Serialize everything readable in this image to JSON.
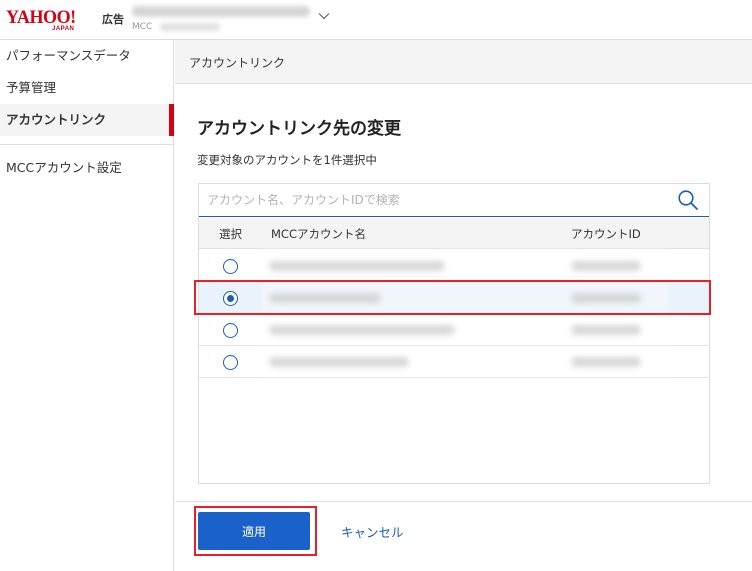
{
  "brand": {
    "logo_text": "YAHOO!",
    "logo_sub": "JAPAN",
    "product": "広告"
  },
  "account_selector": {
    "type_label": "MCC"
  },
  "sidebar": {
    "items": [
      {
        "label": "パフォーマンスデータ",
        "active": false
      },
      {
        "label": "予算管理",
        "active": false
      },
      {
        "label": "アカウントリンク",
        "active": true
      },
      {
        "label": "MCCアカウント設定",
        "active": false
      }
    ]
  },
  "page_header": {
    "title": "アカウントリンク"
  },
  "main": {
    "section_title": "アカウントリンク先の変更",
    "selected_count_text": "変更対象のアカウントを1件選択中",
    "search": {
      "placeholder": "アカウント名、アカウントIDで検索"
    },
    "table": {
      "columns": [
        "選択",
        "MCCアカウント名",
        "アカウントID"
      ],
      "rows": [
        {
          "selected": false
        },
        {
          "selected": true
        },
        {
          "selected": false
        },
        {
          "selected": false
        }
      ]
    },
    "apply_label": "適用",
    "cancel_label": "キャンセル"
  },
  "colors": {
    "brand_red": "#d7000f",
    "accent_blue": "#1a62c9",
    "highlight_red": "#e8202a"
  }
}
